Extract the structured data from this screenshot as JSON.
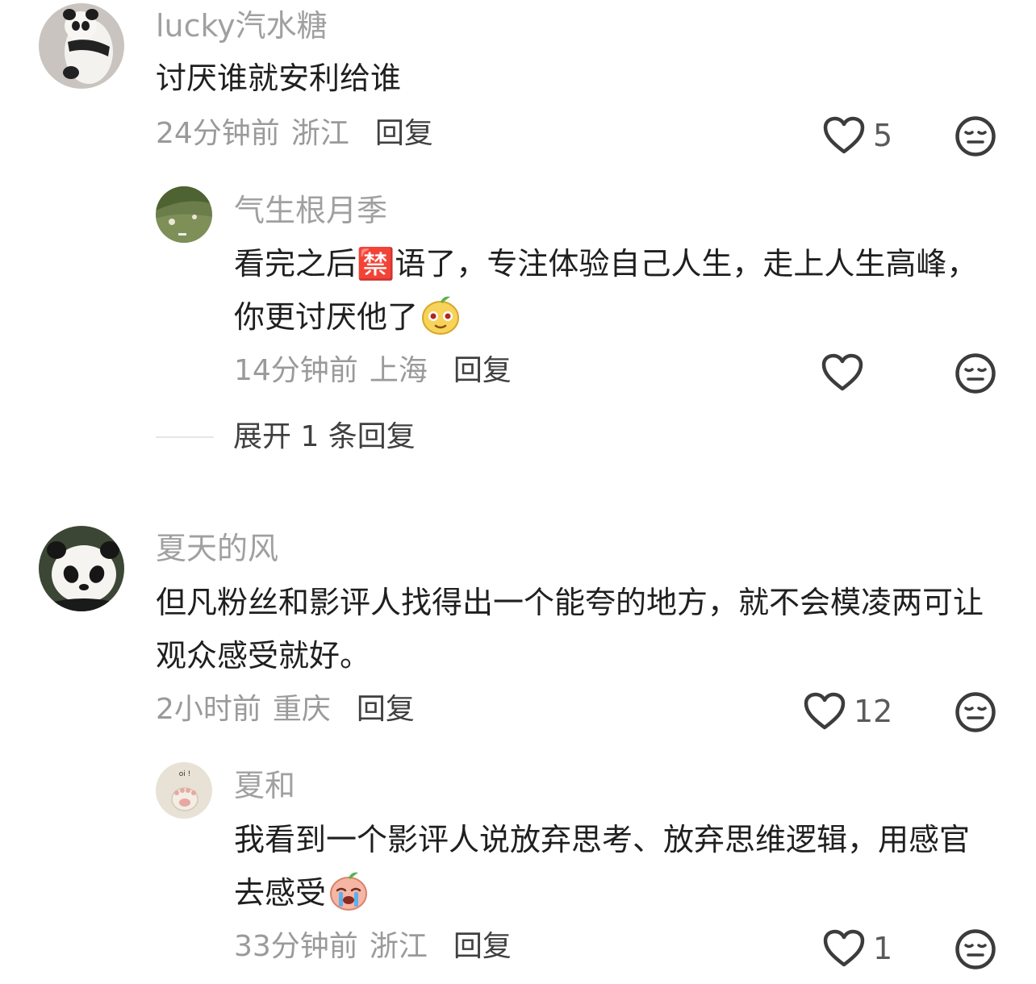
{
  "comments": [
    {
      "username": "lucky汽水糖",
      "avatar_icon": "panda-cub-avatar",
      "text": "讨厌谁就安利给谁",
      "time": "24分钟前",
      "location": "浙江",
      "reply_label": "回复",
      "likes": "5",
      "replies": [
        {
          "username": "气生根月季",
          "avatar_icon": "green-hillside-avatar",
          "text": "看完之后🈲语了，专注体验自己人生，走上人生高峰，你更讨厌他了",
          "emoji": "sly-mango-emoji",
          "time": "14分钟前",
          "location": "上海",
          "reply_label": "回复",
          "likes": ""
        }
      ],
      "expand_label": "展开 1 条回复"
    },
    {
      "username": "夏天的风",
      "avatar_icon": "panda-avatar",
      "text": "但凡粉丝和影评人找得出一个能夸的地方，就不会模凌两可让观众感受就好。",
      "time": "2小时前",
      "location": "重庆",
      "reply_label": "回复",
      "likes": "12",
      "replies": [
        {
          "username": "夏和",
          "avatar_icon": "cat-paw-avatar",
          "avatar_text": "oi !",
          "text": "我看到一个影评人说放弃思考、放弃思维逻辑，用感官去感受",
          "emoji": "crying-peach-emoji",
          "time": "33分钟前",
          "location": "浙江",
          "reply_label": "回复",
          "likes": "1"
        }
      ]
    }
  ],
  "colors": {
    "username": "#a0a0a0",
    "text": "#1f1f1f",
    "meta": "#9a9a9a",
    "reply": "#404040",
    "icon": "#3c3c3c"
  }
}
